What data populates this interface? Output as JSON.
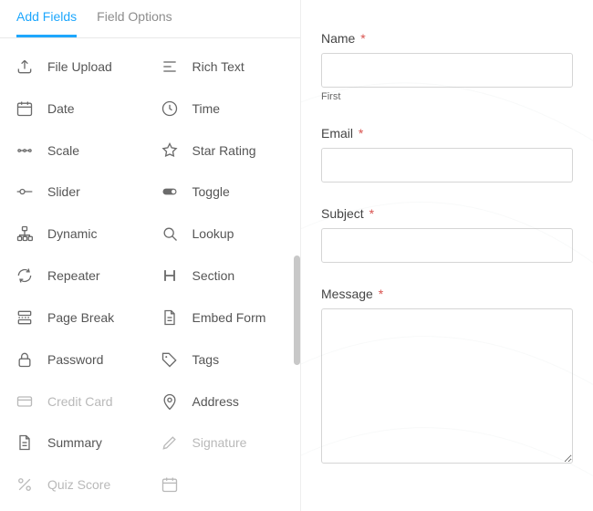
{
  "tabs": {
    "add_fields": "Add Fields",
    "field_options": "Field Options"
  },
  "fields": [
    {
      "key": "file-upload",
      "label": "File Upload",
      "icon": "upload",
      "disabled": false
    },
    {
      "key": "rich-text",
      "label": "Rich Text",
      "icon": "align",
      "disabled": false
    },
    {
      "key": "date",
      "label": "Date",
      "icon": "calendar",
      "disabled": false
    },
    {
      "key": "time",
      "label": "Time",
      "icon": "clock",
      "disabled": false
    },
    {
      "key": "scale",
      "label": "Scale",
      "icon": "scale",
      "disabled": false
    },
    {
      "key": "star-rating",
      "label": "Star Rating",
      "icon": "star",
      "disabled": false
    },
    {
      "key": "slider",
      "label": "Slider",
      "icon": "slider",
      "disabled": false
    },
    {
      "key": "toggle",
      "label": "Toggle",
      "icon": "toggle",
      "disabled": false
    },
    {
      "key": "dynamic",
      "label": "Dynamic",
      "icon": "sitemap",
      "disabled": false
    },
    {
      "key": "lookup",
      "label": "Lookup",
      "icon": "search",
      "disabled": false
    },
    {
      "key": "repeater",
      "label": "Repeater",
      "icon": "repeat",
      "disabled": false
    },
    {
      "key": "section",
      "label": "Section",
      "icon": "heading",
      "disabled": false
    },
    {
      "key": "page-break",
      "label": "Page Break",
      "icon": "break",
      "disabled": false
    },
    {
      "key": "embed-form",
      "label": "Embed Form",
      "icon": "file",
      "disabled": false
    },
    {
      "key": "password",
      "label": "Password",
      "icon": "lock",
      "disabled": false
    },
    {
      "key": "tags",
      "label": "Tags",
      "icon": "tag",
      "disabled": false
    },
    {
      "key": "credit-card",
      "label": "Credit Card",
      "icon": "card",
      "disabled": true
    },
    {
      "key": "address",
      "label": "Address",
      "icon": "pin",
      "disabled": false
    },
    {
      "key": "summary",
      "label": "Summary",
      "icon": "file",
      "disabled": false
    },
    {
      "key": "signature",
      "label": "Signature",
      "icon": "pen",
      "disabled": true
    },
    {
      "key": "quiz-score",
      "label": "Quiz Score",
      "icon": "percent",
      "disabled": true
    },
    {
      "key": "blank",
      "label": "",
      "icon": "calendar",
      "disabled": true
    }
  ],
  "form": {
    "name": {
      "label": "Name",
      "required": true,
      "sublabel": "First",
      "value": ""
    },
    "email": {
      "label": "Email",
      "required": true,
      "value": ""
    },
    "subject": {
      "label": "Subject",
      "required": true,
      "value": ""
    },
    "message": {
      "label": "Message",
      "required": true,
      "value": ""
    }
  },
  "asterisk": "*"
}
